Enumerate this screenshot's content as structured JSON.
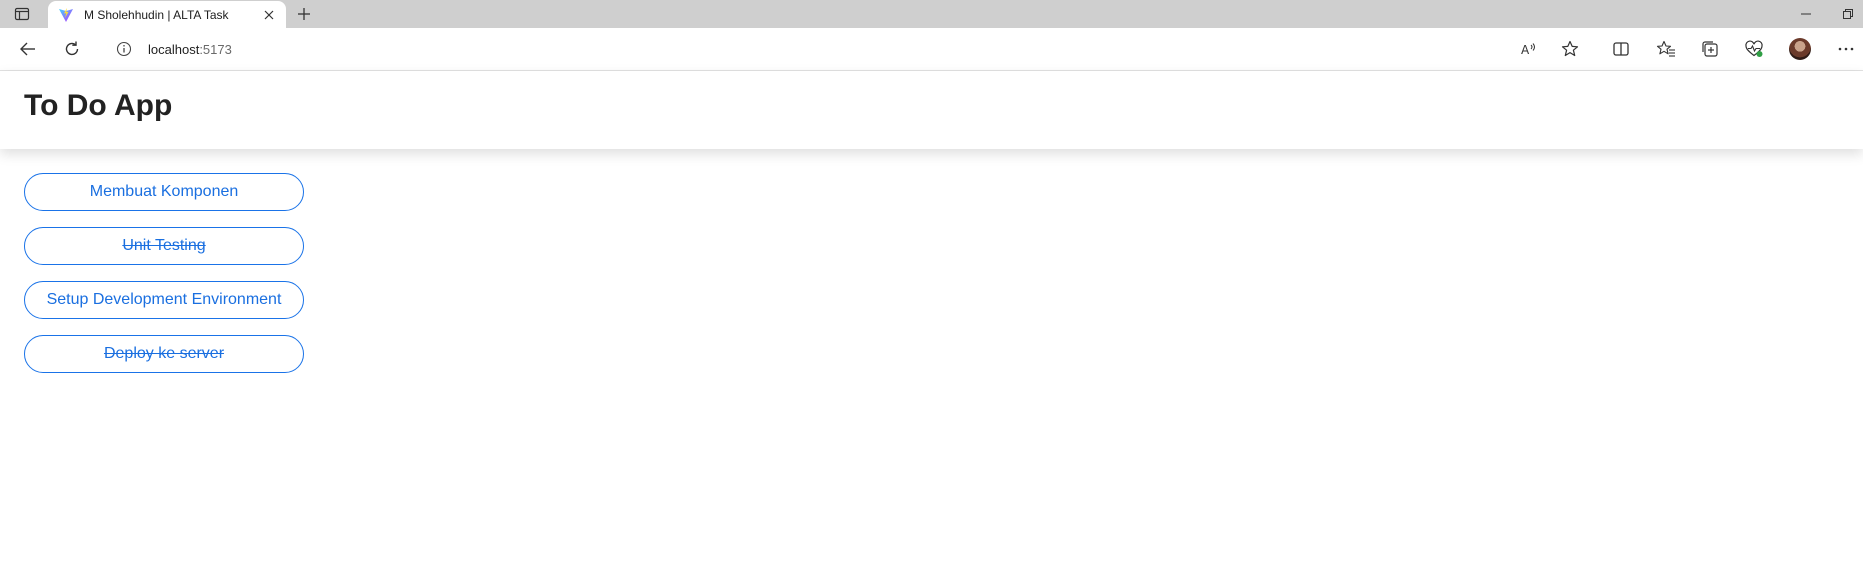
{
  "browser": {
    "tab": {
      "title": "M Sholehhudin | ALTA Task"
    },
    "address": {
      "host": "localhost",
      "port": ":5173"
    },
    "icons": {
      "tab_actions": "tab-actions-icon",
      "favicon": "vite-logo-icon",
      "close": "close-icon",
      "new_tab": "plus-icon",
      "back": "back-arrow-icon",
      "refresh": "refresh-icon",
      "site_info": "info-icon",
      "read_aloud": "read-aloud-icon",
      "favorite": "star-icon",
      "split_screen": "split-screen-icon",
      "favorites": "favorites-icon",
      "collections": "collections-icon",
      "browser_essentials": "heart-pulse-icon",
      "profile": "avatar",
      "more": "more-icon"
    }
  },
  "app": {
    "title": "To Do App",
    "accent_color": "#1a73e8",
    "todos": [
      {
        "label": "Membuat Komponen",
        "completed": false
      },
      {
        "label": "Unit Testing",
        "completed": true
      },
      {
        "label": "Setup Development Environment",
        "completed": false
      },
      {
        "label": "Deploy ke server",
        "completed": true
      }
    ]
  }
}
